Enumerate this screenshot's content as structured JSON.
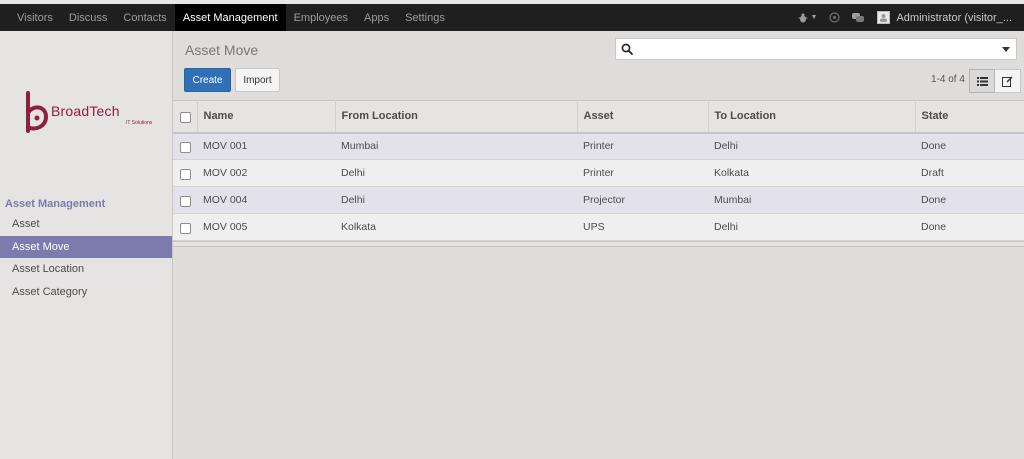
{
  "topbar": {
    "menu": [
      {
        "label": "Visitors",
        "active": false
      },
      {
        "label": "Discuss",
        "active": false
      },
      {
        "label": "Contacts",
        "active": false
      },
      {
        "label": "Asset Management",
        "active": true
      },
      {
        "label": "Employees",
        "active": false
      },
      {
        "label": "Apps",
        "active": false
      },
      {
        "label": "Settings",
        "active": false
      }
    ],
    "user": "Administrator (visitor_..."
  },
  "logo": {
    "brand": "BroadTech",
    "tagline": "IT Solutions",
    "color": "#8f1f3f"
  },
  "sidebar": {
    "section": "Asset Management",
    "items": [
      {
        "label": "Asset",
        "active": false
      },
      {
        "label": "Asset Move",
        "active": true
      },
      {
        "label": "Asset Location",
        "active": false
      },
      {
        "label": "Asset Category",
        "active": false
      }
    ]
  },
  "main": {
    "title": "Asset Move",
    "search": {
      "placeholder": ""
    },
    "create_label": "Create",
    "import_label": "Import",
    "pager": "1-4 of 4"
  },
  "table": {
    "columns": [
      "Name",
      "From Location",
      "Asset",
      "To Location",
      "State"
    ],
    "rows": [
      [
        "MOV 001",
        "Mumbai",
        "Printer",
        "Delhi",
        "Done"
      ],
      [
        "MOV 002",
        "Delhi",
        "Printer",
        "Kolkata",
        "Draft"
      ],
      [
        "MOV 004",
        "Delhi",
        "Projector",
        "Mumbai",
        "Done"
      ],
      [
        "MOV 005",
        "Kolkata",
        "UPS",
        "Delhi",
        "Done"
      ]
    ]
  },
  "colors": {
    "accent": "#7c7bad",
    "primary_button": "#2f71b5",
    "topbar": "#1f1f1f"
  }
}
